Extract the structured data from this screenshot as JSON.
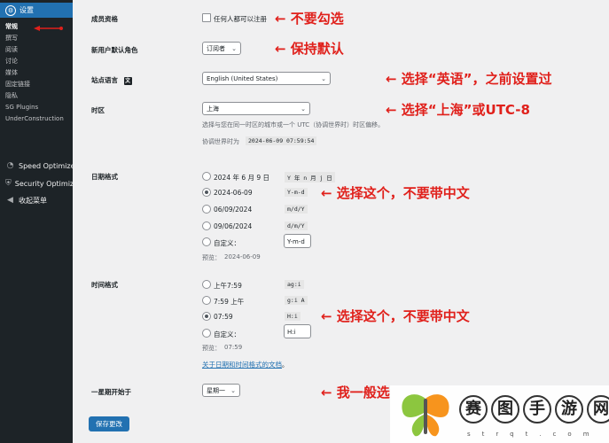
{
  "sidebar": {
    "header": "设置",
    "sub_items": [
      {
        "label": "常规",
        "active": true
      },
      {
        "label": "撰写"
      },
      {
        "label": "阅读"
      },
      {
        "label": "讨论"
      },
      {
        "label": "媒体"
      },
      {
        "label": "固定链接"
      },
      {
        "label": "隐私"
      },
      {
        "label": "SG Plugins"
      },
      {
        "label": "UnderConstruction"
      }
    ],
    "menus": [
      {
        "label": "Speed Optimizer",
        "icon": "gauge-icon"
      },
      {
        "label": "Security Optimizer",
        "icon": "shield-icon"
      },
      {
        "label": "收起菜单",
        "icon": "collapse-icon"
      }
    ]
  },
  "membership": {
    "label": "成员资格",
    "checkbox_label": "任何人都可以注册"
  },
  "default_role": {
    "label": "新用户默认角色",
    "value": "订阅者"
  },
  "site_language": {
    "label": "站点语言",
    "value": "English (United States)"
  },
  "timezone": {
    "label": "时区",
    "value": "上海",
    "help": "选择与您在同一时区的城市或一个 UTC（协调世界时）时区偏移。",
    "utc_label": "协调世界时为",
    "utc_value": "2024-06-09 07:59:54"
  },
  "date_format": {
    "label": "日期格式",
    "options": [
      {
        "text": "2024 年 6 月 9 日",
        "code": "Y 年 n 月 j 日"
      },
      {
        "text": "2024-06-09",
        "code": "Y-m-d",
        "selected": true
      },
      {
        "text": "06/09/2024",
        "code": "m/d/Y"
      },
      {
        "text": "09/06/2024",
        "code": "d/m/Y"
      }
    ],
    "custom_label": "自定义：",
    "custom_value": "Y-m-d",
    "preview_label": "预览：",
    "preview_value": "2024-06-09"
  },
  "time_format": {
    "label": "时间格式",
    "options": [
      {
        "text": "上午7:59",
        "code": "ag:i"
      },
      {
        "text": "7:59 上午",
        "code": "g:i A"
      },
      {
        "text": "07:59",
        "code": "H:i",
        "selected": true
      }
    ],
    "custom_label": "自定义：",
    "custom_value": "H:i",
    "preview_label": "预览：",
    "preview_value": "07:59",
    "doc_link": "关于日期和时间格式的文档",
    "doc_link_suffix": "。"
  },
  "week_start": {
    "label": "一星期开始于",
    "value": "星期一"
  },
  "save_button": "保存更改",
  "annotations": {
    "a1": "← 不要勾选",
    "a2": "← 保持默认",
    "a3": "← 选择“英语”，之前设置过",
    "a4": "← 选择“上海”或UTC-8",
    "a5": "← 选择这个，不要带中文",
    "a6": "← 选择这个，不要带中文",
    "a7": "← 我一般选"
  },
  "watermark": {
    "chars": [
      "赛",
      "图",
      "手",
      "游",
      "网"
    ],
    "sub": "strqt.com"
  },
  "colors": {
    "accent": "#2271b1",
    "annotation": "#e0201b",
    "sidebar": "#1d2327"
  }
}
